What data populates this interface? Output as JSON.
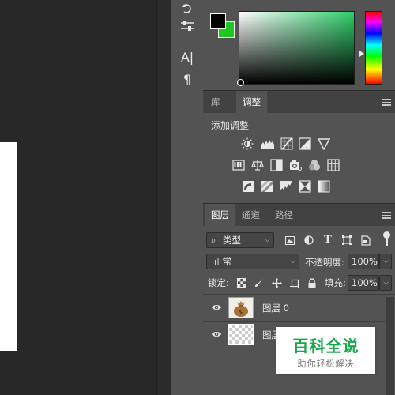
{
  "colors": {
    "panel_bg": "#535353",
    "tab_bar_bg": "#424242",
    "workspace_bg": "#282828",
    "foreground_color": "#000000",
    "background_color": "#1ec81e",
    "picker_hue": "#2fcf6b",
    "watermark_green": "#1aa84d"
  },
  "toolbar": {
    "icons": [
      "history-icon",
      "properties-sliders-icon",
      "character-icon",
      "paragraph-icon"
    ],
    "character_glyph": "A|",
    "paragraph_glyph": "¶"
  },
  "library_tabs": [
    {
      "label": "库",
      "active": false
    },
    {
      "label": "调整",
      "active": true
    }
  ],
  "adjustments": {
    "title": "添加调整",
    "rows": [
      [
        "brightness-contrast-icon",
        "levels-icon",
        "curves-icon",
        "exposure-icon",
        "vibrance-icon"
      ],
      [
        "hue-saturation-icon",
        "color-balance-icon",
        "black-white-icon",
        "photo-filter-icon",
        "channel-mixer-icon",
        "color-lookup-icon"
      ],
      [
        "invert-icon",
        "posterize-icon",
        "threshold-icon",
        "selective-color-icon",
        "gradient-map-icon"
      ]
    ]
  },
  "layers_tabs": [
    {
      "label": "图层",
      "active": true
    },
    {
      "label": "通道",
      "active": false
    },
    {
      "label": "路径",
      "active": false
    }
  ],
  "layers": {
    "filter_kind": "类型",
    "blend_mode": "正常",
    "opacity_label": "不透明度:",
    "opacity_value": "100%",
    "lock_label": "锁定:",
    "fill_label": "填充:",
    "fill_value": "100%",
    "items": [
      {
        "name": "图层 0",
        "thumbnail": "money-bag"
      },
      {
        "name": "图层",
        "thumbnail": "transparent"
      }
    ]
  },
  "watermark": {
    "title": "百科全说",
    "subtitle": "助你轻松解决"
  }
}
